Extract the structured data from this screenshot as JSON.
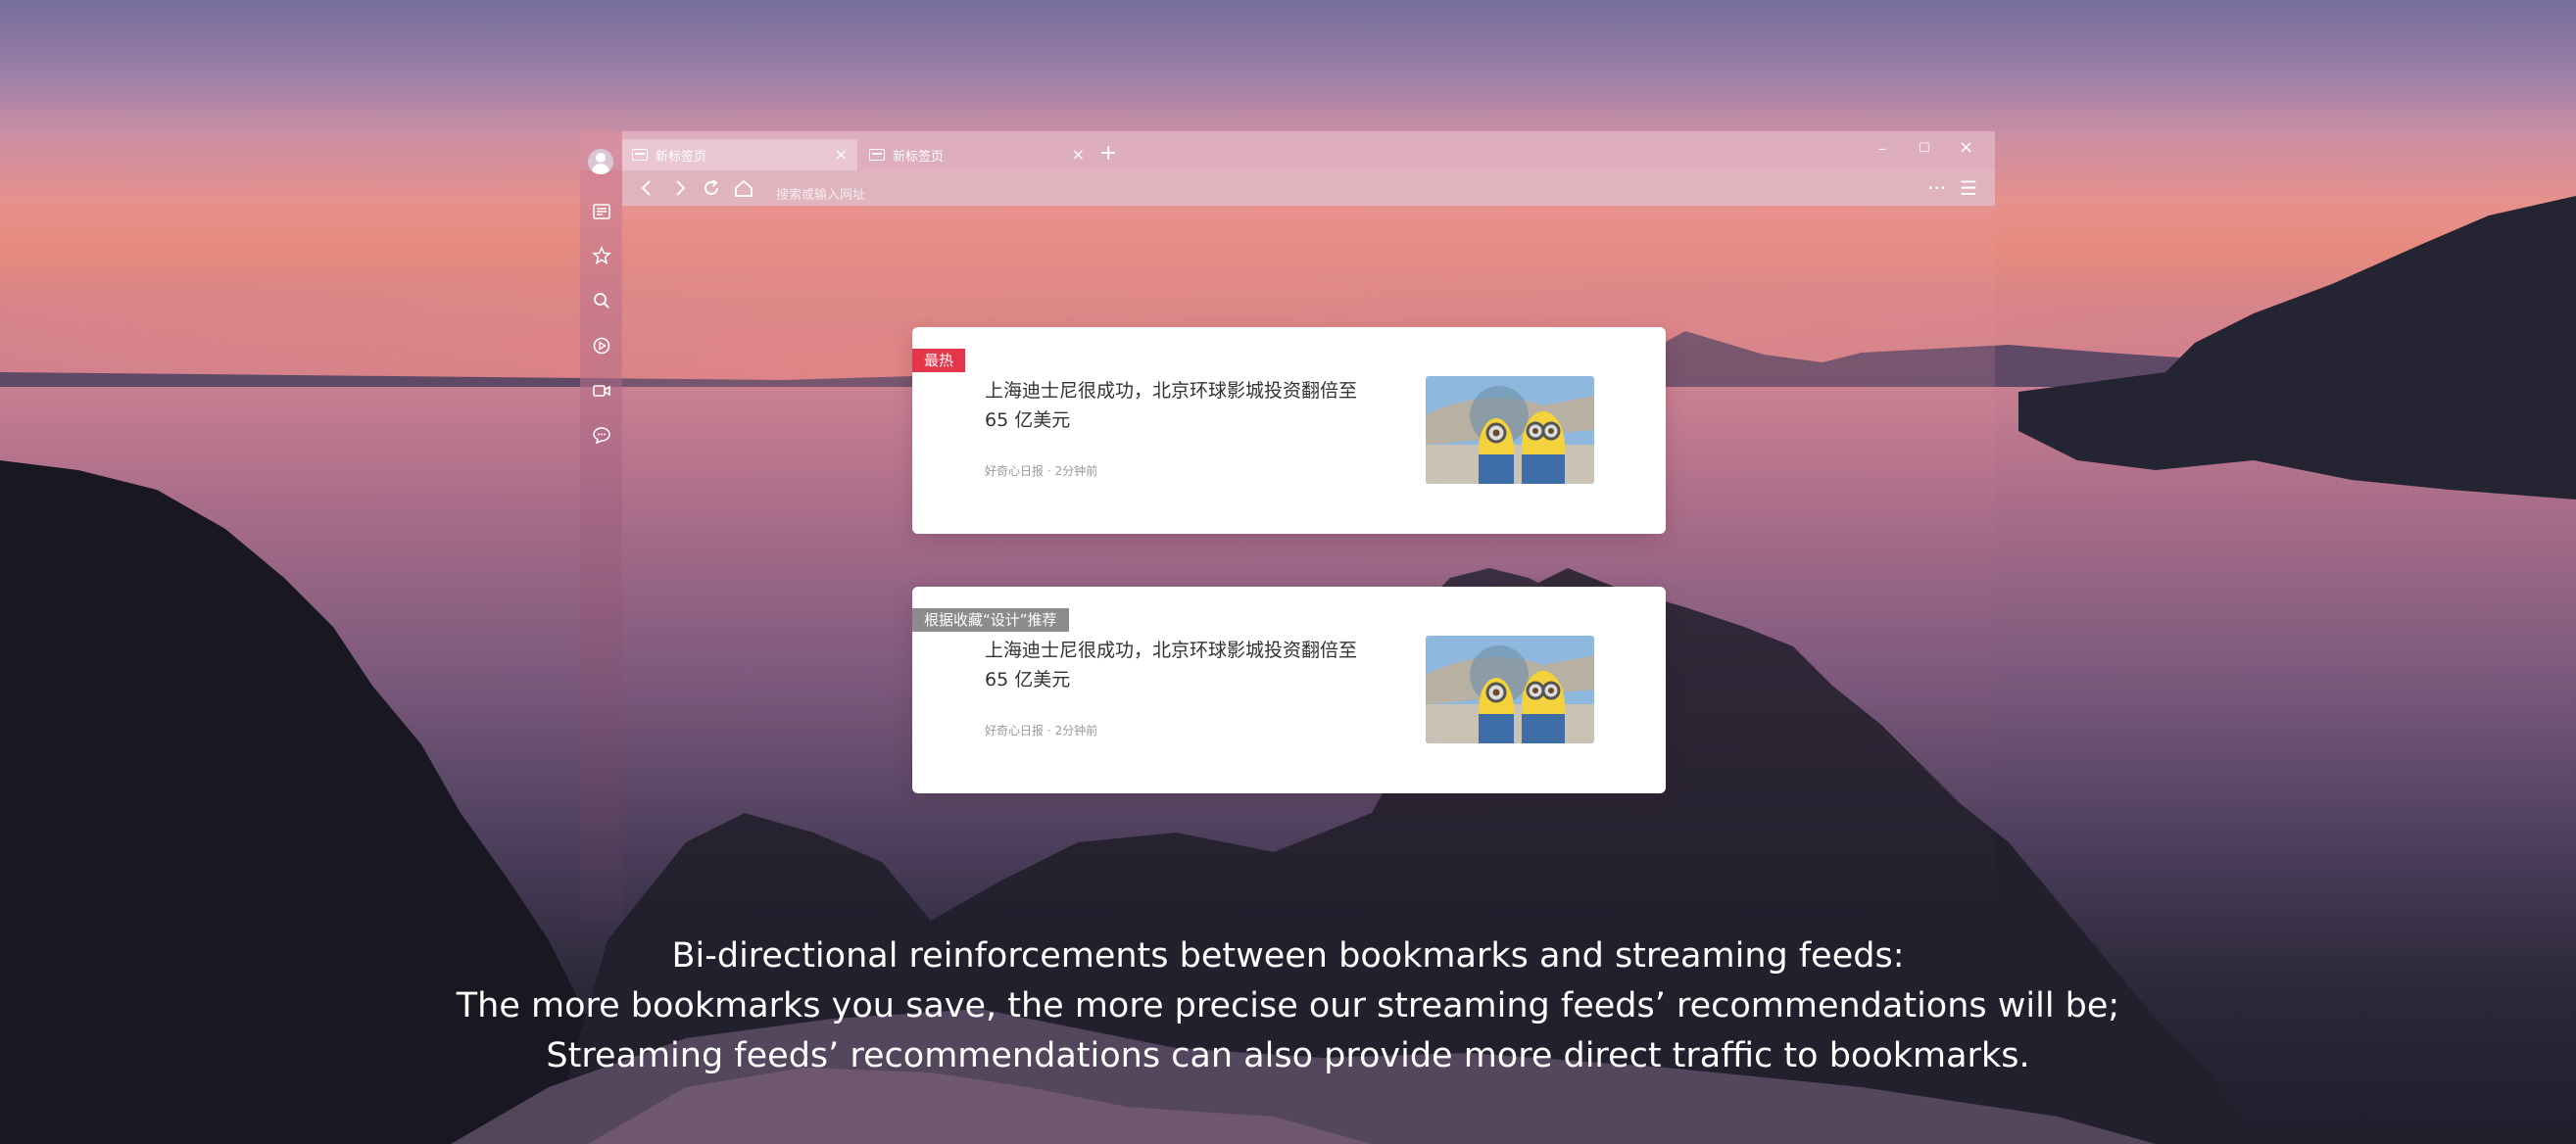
{
  "browser": {
    "tabs": [
      {
        "title": "新标签页",
        "close": "×"
      },
      {
        "title": "新标签页",
        "close": "×"
      }
    ],
    "new_tab": "+",
    "window_controls": {
      "minimize": "–",
      "maximize": "☐",
      "close": "×"
    },
    "address_bar": {
      "placeholder": "搜索或输入网址"
    },
    "toolbar": {
      "more": "···",
      "menu": "☰"
    }
  },
  "sidebar": {
    "items": [
      {
        "icon": "avatar"
      },
      {
        "icon": "news-icon"
      },
      {
        "icon": "star-icon"
      },
      {
        "icon": "search-icon"
      },
      {
        "icon": "play-icon"
      },
      {
        "icon": "video-icon"
      },
      {
        "icon": "chat-icon"
      }
    ]
  },
  "feed": [
    {
      "badge": "最热",
      "badge_color": "#e5354a",
      "headline": "上海迪士尼很成功，北京环球影城投资翻倍至 65 亿美元",
      "source": "好奇心日报",
      "dot": "·",
      "time": "2分钟前"
    },
    {
      "badge": "根据收藏“设计”推荐",
      "badge_color": "#8c8c8c",
      "headline": "上海迪士尼很成功，北京环球影城投资翻倍至 65 亿美元",
      "source": "好奇心日报",
      "dot": "·",
      "time": "2分钟前"
    }
  ],
  "caption": {
    "line1": "Bi-directional reinforcements between bookmarks and streaming feeds:",
    "line2": "The more bookmarks you save, the more precise our streaming feeds’ recommendations will be;",
    "line3": "Streaming feeds’ recommendations can also provide more direct traffic to bookmarks."
  }
}
